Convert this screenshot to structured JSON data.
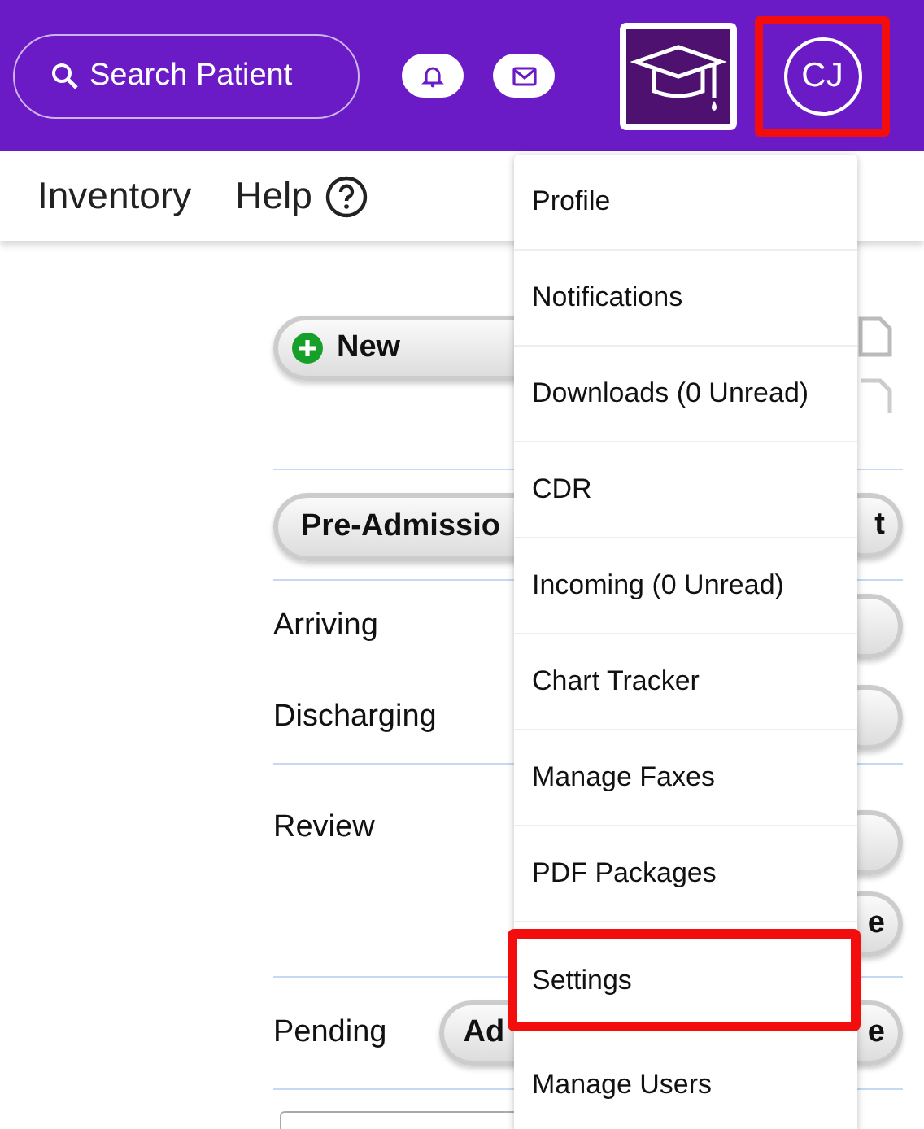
{
  "header": {
    "search_label": "Search Patient",
    "avatar": {
      "initials": "CJ",
      "highlighted": true
    }
  },
  "nav": {
    "items": [
      "Inventory",
      "Help"
    ]
  },
  "content": {
    "new_button": "New",
    "pre_admission": {
      "label": "Pre-Admissio",
      "right_fragment": "t"
    },
    "rows": [
      {
        "label": "Arriving"
      },
      {
        "label": "Discharging"
      }
    ],
    "review": {
      "label": "Review",
      "right_fragment": "e"
    },
    "pending": {
      "label": "Pending",
      "button_fragment": "Ad",
      "right_fragment": "e"
    }
  },
  "menu": {
    "items": [
      {
        "label": "Profile",
        "highlighted": false
      },
      {
        "label": "Notifications",
        "highlighted": false
      },
      {
        "label": "Downloads (0 Unread)",
        "highlighted": false
      },
      {
        "label": "CDR",
        "highlighted": false
      },
      {
        "label": "Incoming (0 Unread)",
        "highlighted": false
      },
      {
        "label": "Chart Tracker",
        "highlighted": false
      },
      {
        "label": "Manage Faxes",
        "highlighted": false
      },
      {
        "label": "PDF Packages",
        "highlighted": false
      },
      {
        "label": "Settings",
        "highlighted": true
      },
      {
        "label": "Manage Users",
        "highlighted": false
      }
    ]
  }
}
